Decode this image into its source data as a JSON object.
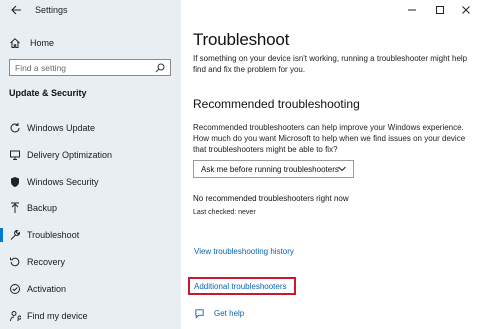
{
  "window": {
    "title": "Settings"
  },
  "sidebar": {
    "home_label": "Home",
    "search_placeholder": "Find a setting",
    "section_title": "Update & Security",
    "items": [
      {
        "label": "Windows Update",
        "icon": "refresh-icon"
      },
      {
        "label": "Delivery Optimization",
        "icon": "delivery-optimization-icon"
      },
      {
        "label": "Windows Security",
        "icon": "shield-icon"
      },
      {
        "label": "Backup",
        "icon": "backup-arrow-icon"
      },
      {
        "label": "Troubleshoot",
        "icon": "wrench-icon",
        "active": true
      },
      {
        "label": "Recovery",
        "icon": "recovery-icon"
      },
      {
        "label": "Activation",
        "icon": "check-circle-icon"
      },
      {
        "label": "Find my device",
        "icon": "person-location-icon"
      }
    ]
  },
  "main": {
    "title": "Troubleshoot",
    "intro": "If something on your device isn't working, running a troubleshooter might help find and fix the problem for you.",
    "recommended": {
      "heading": "Recommended troubleshooting",
      "description": "Recommended troubleshooters can help improve your Windows experience. How much do you want Microsoft to help when we find issues on your device that troubleshooters might be able to fix?",
      "dropdown_value": "Ask me before running troubleshooters",
      "status": "No recommended troubleshooters right now",
      "last_checked": "Last checked: never"
    },
    "history_link": "View troubleshooting history",
    "additional_link": "Additional troubleshooters",
    "help_label": "Get help"
  },
  "colors": {
    "accent": "#0078d4",
    "link": "#0a64b4",
    "highlight": "#c8192e",
    "sidebar_bg": "#e9eef2"
  }
}
